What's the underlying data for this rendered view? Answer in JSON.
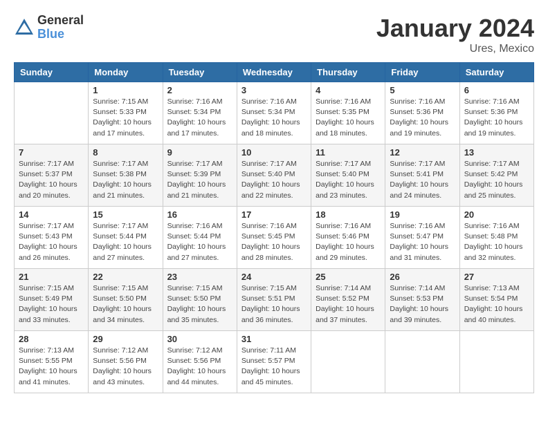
{
  "header": {
    "logo_general": "General",
    "logo_blue": "Blue",
    "month_year": "January 2024",
    "location": "Ures, Mexico"
  },
  "weekdays": [
    "Sunday",
    "Monday",
    "Tuesday",
    "Wednesday",
    "Thursday",
    "Friday",
    "Saturday"
  ],
  "weeks": [
    [
      {
        "num": "",
        "sunrise": "",
        "sunset": "",
        "daylight": ""
      },
      {
        "num": "1",
        "sunrise": "Sunrise: 7:15 AM",
        "sunset": "Sunset: 5:33 PM",
        "daylight": "Daylight: 10 hours and 17 minutes."
      },
      {
        "num": "2",
        "sunrise": "Sunrise: 7:16 AM",
        "sunset": "Sunset: 5:34 PM",
        "daylight": "Daylight: 10 hours and 17 minutes."
      },
      {
        "num": "3",
        "sunrise": "Sunrise: 7:16 AM",
        "sunset": "Sunset: 5:34 PM",
        "daylight": "Daylight: 10 hours and 18 minutes."
      },
      {
        "num": "4",
        "sunrise": "Sunrise: 7:16 AM",
        "sunset": "Sunset: 5:35 PM",
        "daylight": "Daylight: 10 hours and 18 minutes."
      },
      {
        "num": "5",
        "sunrise": "Sunrise: 7:16 AM",
        "sunset": "Sunset: 5:36 PM",
        "daylight": "Daylight: 10 hours and 19 minutes."
      },
      {
        "num": "6",
        "sunrise": "Sunrise: 7:16 AM",
        "sunset": "Sunset: 5:36 PM",
        "daylight": "Daylight: 10 hours and 19 minutes."
      }
    ],
    [
      {
        "num": "7",
        "sunrise": "Sunrise: 7:17 AM",
        "sunset": "Sunset: 5:37 PM",
        "daylight": "Daylight: 10 hours and 20 minutes."
      },
      {
        "num": "8",
        "sunrise": "Sunrise: 7:17 AM",
        "sunset": "Sunset: 5:38 PM",
        "daylight": "Daylight: 10 hours and 21 minutes."
      },
      {
        "num": "9",
        "sunrise": "Sunrise: 7:17 AM",
        "sunset": "Sunset: 5:39 PM",
        "daylight": "Daylight: 10 hours and 21 minutes."
      },
      {
        "num": "10",
        "sunrise": "Sunrise: 7:17 AM",
        "sunset": "Sunset: 5:40 PM",
        "daylight": "Daylight: 10 hours and 22 minutes."
      },
      {
        "num": "11",
        "sunrise": "Sunrise: 7:17 AM",
        "sunset": "Sunset: 5:40 PM",
        "daylight": "Daylight: 10 hours and 23 minutes."
      },
      {
        "num": "12",
        "sunrise": "Sunrise: 7:17 AM",
        "sunset": "Sunset: 5:41 PM",
        "daylight": "Daylight: 10 hours and 24 minutes."
      },
      {
        "num": "13",
        "sunrise": "Sunrise: 7:17 AM",
        "sunset": "Sunset: 5:42 PM",
        "daylight": "Daylight: 10 hours and 25 minutes."
      }
    ],
    [
      {
        "num": "14",
        "sunrise": "Sunrise: 7:17 AM",
        "sunset": "Sunset: 5:43 PM",
        "daylight": "Daylight: 10 hours and 26 minutes."
      },
      {
        "num": "15",
        "sunrise": "Sunrise: 7:17 AM",
        "sunset": "Sunset: 5:44 PM",
        "daylight": "Daylight: 10 hours and 27 minutes."
      },
      {
        "num": "16",
        "sunrise": "Sunrise: 7:16 AM",
        "sunset": "Sunset: 5:44 PM",
        "daylight": "Daylight: 10 hours and 27 minutes."
      },
      {
        "num": "17",
        "sunrise": "Sunrise: 7:16 AM",
        "sunset": "Sunset: 5:45 PM",
        "daylight": "Daylight: 10 hours and 28 minutes."
      },
      {
        "num": "18",
        "sunrise": "Sunrise: 7:16 AM",
        "sunset": "Sunset: 5:46 PM",
        "daylight": "Daylight: 10 hours and 29 minutes."
      },
      {
        "num": "19",
        "sunrise": "Sunrise: 7:16 AM",
        "sunset": "Sunset: 5:47 PM",
        "daylight": "Daylight: 10 hours and 31 minutes."
      },
      {
        "num": "20",
        "sunrise": "Sunrise: 7:16 AM",
        "sunset": "Sunset: 5:48 PM",
        "daylight": "Daylight: 10 hours and 32 minutes."
      }
    ],
    [
      {
        "num": "21",
        "sunrise": "Sunrise: 7:15 AM",
        "sunset": "Sunset: 5:49 PM",
        "daylight": "Daylight: 10 hours and 33 minutes."
      },
      {
        "num": "22",
        "sunrise": "Sunrise: 7:15 AM",
        "sunset": "Sunset: 5:50 PM",
        "daylight": "Daylight: 10 hours and 34 minutes."
      },
      {
        "num": "23",
        "sunrise": "Sunrise: 7:15 AM",
        "sunset": "Sunset: 5:50 PM",
        "daylight": "Daylight: 10 hours and 35 minutes."
      },
      {
        "num": "24",
        "sunrise": "Sunrise: 7:15 AM",
        "sunset": "Sunset: 5:51 PM",
        "daylight": "Daylight: 10 hours and 36 minutes."
      },
      {
        "num": "25",
        "sunrise": "Sunrise: 7:14 AM",
        "sunset": "Sunset: 5:52 PM",
        "daylight": "Daylight: 10 hours and 37 minutes."
      },
      {
        "num": "26",
        "sunrise": "Sunrise: 7:14 AM",
        "sunset": "Sunset: 5:53 PM",
        "daylight": "Daylight: 10 hours and 39 minutes."
      },
      {
        "num": "27",
        "sunrise": "Sunrise: 7:13 AM",
        "sunset": "Sunset: 5:54 PM",
        "daylight": "Daylight: 10 hours and 40 minutes."
      }
    ],
    [
      {
        "num": "28",
        "sunrise": "Sunrise: 7:13 AM",
        "sunset": "Sunset: 5:55 PM",
        "daylight": "Daylight: 10 hours and 41 minutes."
      },
      {
        "num": "29",
        "sunrise": "Sunrise: 7:12 AM",
        "sunset": "Sunset: 5:56 PM",
        "daylight": "Daylight: 10 hours and 43 minutes."
      },
      {
        "num": "30",
        "sunrise": "Sunrise: 7:12 AM",
        "sunset": "Sunset: 5:56 PM",
        "daylight": "Daylight: 10 hours and 44 minutes."
      },
      {
        "num": "31",
        "sunrise": "Sunrise: 7:11 AM",
        "sunset": "Sunset: 5:57 PM",
        "daylight": "Daylight: 10 hours and 45 minutes."
      },
      {
        "num": "",
        "sunrise": "",
        "sunset": "",
        "daylight": ""
      },
      {
        "num": "",
        "sunrise": "",
        "sunset": "",
        "daylight": ""
      },
      {
        "num": "",
        "sunrise": "",
        "sunset": "",
        "daylight": ""
      }
    ]
  ]
}
